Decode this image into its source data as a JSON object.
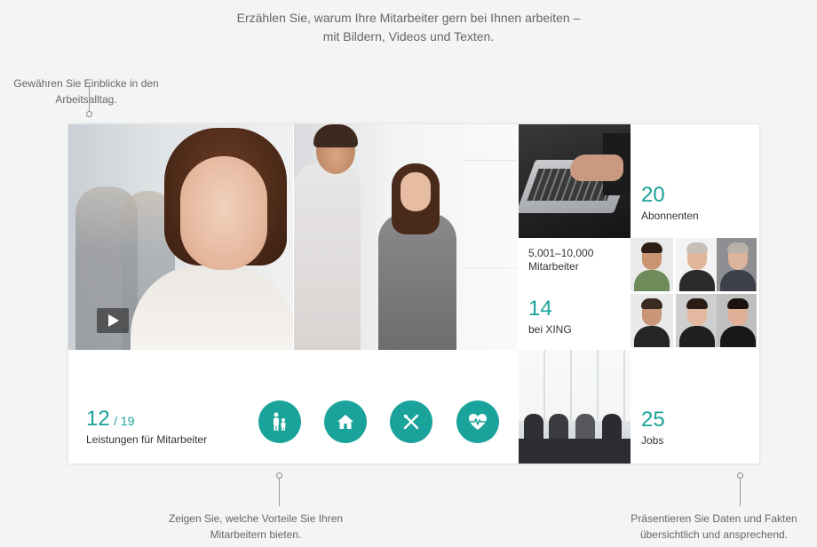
{
  "heading": {
    "line1": "Erzählen Sie, warum Ihre Mitarbeiter gern bei Ihnen arbeiten –",
    "line2": "mit Bildern, Videos und Texten."
  },
  "callouts": {
    "left": {
      "line1": "Gewähren Sie Einblicke in den",
      "line2": "Arbeitsalltag."
    },
    "middle": {
      "line1": "Zeigen Sie, welche Vorteile Sie Ihren",
      "line2": "Mitarbeitern bieten."
    },
    "right": {
      "line1": "Präsentieren Sie Daten und Fakten",
      "line2": "übersichtlich und ansprechend."
    }
  },
  "stats": {
    "employees": {
      "value": "5,001–10,000",
      "label": "Mitarbeiter"
    },
    "xing": {
      "value": "14",
      "label": "bei XING"
    },
    "subscribers": {
      "value": "20",
      "label": "Abonnenten"
    },
    "jobs": {
      "value": "25",
      "label": "Jobs"
    }
  },
  "benefits": {
    "count": "12",
    "total": "/ 19",
    "label": "Leistungen für Mitarbeiter",
    "icons": [
      "family-icon",
      "home-icon",
      "cutlery-icon",
      "heart-rate-icon"
    ]
  },
  "colors": {
    "accent": "#1aa39a",
    "background": "#f4f4f4",
    "card": "#ffffff"
  }
}
